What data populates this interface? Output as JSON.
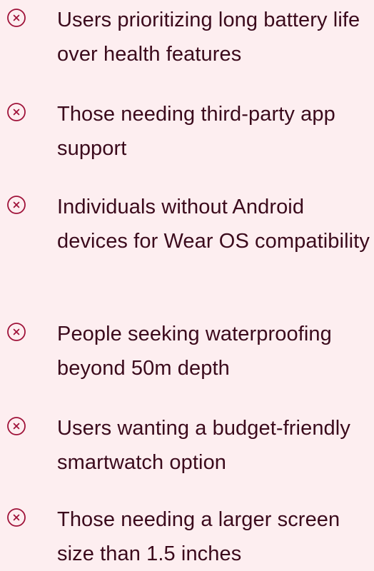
{
  "colors": {
    "background": "#fdeef0",
    "text": "#3b0a1c",
    "icon": "#9f1239"
  },
  "list": {
    "icon_name": "x-circle-icon",
    "items": [
      {
        "text": "Users prioritizing long battery life over health features"
      },
      {
        "text": "Those needing third-party app support"
      },
      {
        "text": "Individuals without Android devices for Wear OS compatibility"
      },
      {
        "text": "People seeking waterproofing beyond 50m depth"
      },
      {
        "text": "Users wanting a budget-friendly smartwatch option"
      },
      {
        "text": "Those needing a larger screen size than 1.5 inches"
      }
    ]
  }
}
